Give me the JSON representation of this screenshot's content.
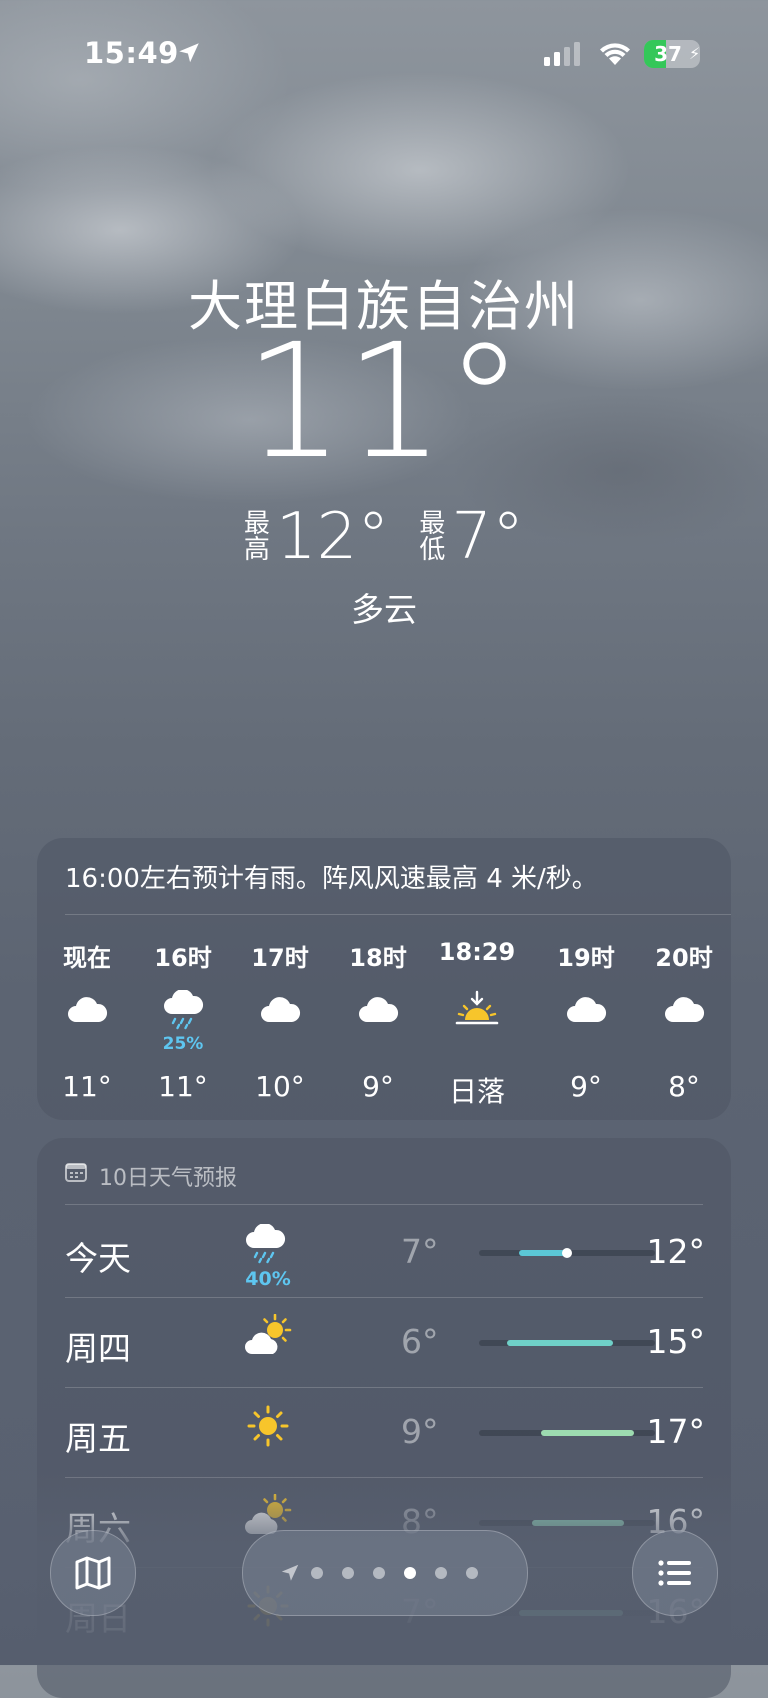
{
  "status_bar": {
    "time": "15:49",
    "battery": "37"
  },
  "header": {
    "city": "大理白族自治州",
    "temperature": "11°",
    "high_label": "最高",
    "high": "12°",
    "low_label": "最低",
    "low": "7°",
    "condition": "多云"
  },
  "hourly": {
    "summary": "16:00左右预计有雨。阵风风速最高 4 米/秒。",
    "items": [
      {
        "label": "现在",
        "icon": "cloud-icon",
        "pop": "",
        "temp": "11°"
      },
      {
        "label": "16时",
        "icon": "cloud-rain-icon",
        "pop": "25%",
        "temp": "11°"
      },
      {
        "label": "17时",
        "icon": "cloud-icon",
        "pop": "",
        "temp": "10°"
      },
      {
        "label": "18时",
        "icon": "cloud-icon",
        "pop": "",
        "temp": "9°"
      },
      {
        "label": "18:29",
        "icon": "sunset-icon",
        "pop": "",
        "temp": "日落"
      },
      {
        "label": "19时",
        "icon": "cloud-icon",
        "pop": "",
        "temp": "9°"
      },
      {
        "label": "20时",
        "icon": "cloud-icon",
        "pop": "",
        "temp": "8°"
      }
    ]
  },
  "daily": {
    "header": "10日天气预报",
    "days": [
      {
        "name": "今天",
        "icon": "cloud-rain-icon",
        "pop": "40%",
        "low": "7°",
        "high": "12°",
        "range_start": 0.23,
        "range_end": 0.52,
        "current": 0.5,
        "color": "#5bc7d6"
      },
      {
        "name": "周四",
        "icon": "partly-sunny-icon",
        "pop": "",
        "low": "6°",
        "high": "15°",
        "range_start": 0.16,
        "range_end": 0.76,
        "color": "#6fd0c8"
      },
      {
        "name": "周五",
        "icon": "sun-icon",
        "pop": "",
        "low": "9°",
        "high": "17°",
        "range_start": 0.35,
        "range_end": 0.88,
        "color": "#9ddbb0"
      },
      {
        "name": "周六",
        "icon": "partly-sunny-icon",
        "pop": "",
        "low": "8°",
        "high": "16°",
        "range_start": 0.3,
        "range_end": 0.82,
        "color": "#8fd6bb"
      },
      {
        "name": "周日",
        "icon": "sun-icon",
        "pop": "",
        "low": "7°",
        "high": "16°",
        "range_start": 0.23,
        "range_end": 0.82,
        "color": "#8fd6bb"
      }
    ]
  },
  "pager": {
    "pages": 6,
    "active": 3
  }
}
